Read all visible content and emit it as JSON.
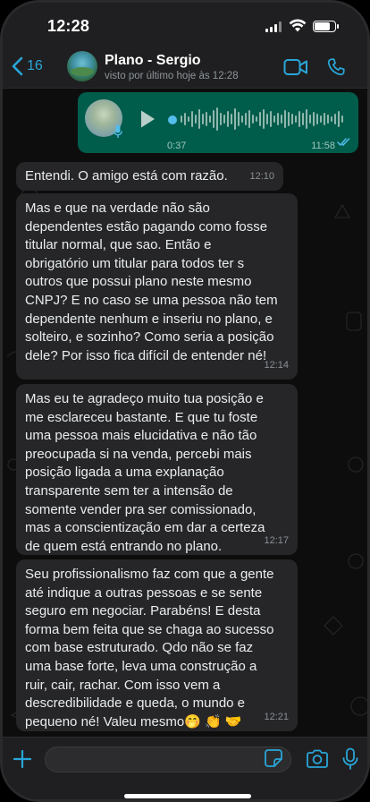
{
  "status_bar": {
    "time": "12:28",
    "battery_level": 0.85
  },
  "header": {
    "back_count": "16",
    "contact_name": "Plano - Sergio",
    "contact_status": "visto por último hoje às 12:28"
  },
  "voice_message": {
    "duration": "0:37",
    "time": "11:58",
    "status": "read"
  },
  "messages": [
    {
      "text": "Entendi. O amigo está com razão.",
      "time": "12:10"
    },
    {
      "text": "Mas e que na verdade não são\ndependentes estão pagando como fosse\ntitular normal, que sao. Então e\nobrigatório um titular para todos ter s\noutros que possui plano neste mesmo\nCNPJ? E no caso se uma pessoa não tem\ndependente nenhum e inseriu no plano, e\nsolteiro, e sozinho? Como seria a posição\ndele? Por isso fica difícil de entender né!",
      "time": "12:14"
    },
    {
      "text": "Mas eu te agradeço muito tua posição e\nme esclareceu bastante. E que tu foste\numa pessoa mais elucidativa e não tão\npreocupada si na venda, percebi mais\nposição ligada a uma explanação\ntransparente sem ter a intensão de\nsomente vender pra ser comissionado,\nmas a conscientização em dar a certeza\nde quem está entrando no plano.",
      "time": "12:17"
    },
    {
      "text": "Seu profissionalismo faz com que a gente\naté indique a outras pessoas e se sente\nseguro em negociar. Parabéns! E desta\nforma bem feita que se chaga ao sucesso\ncom base estruturado. Qdo não se faz\numa base forte, leva uma construção a\nruir, cair, rachar. Com isso vem a\ndescredibilidade e queda, o mundo e\npequeno né! Valeu mesmo🤭 👏 🤝",
      "time": "12:21"
    }
  ],
  "input": {
    "placeholder": ""
  },
  "colors": {
    "accent": "#2aa6d9",
    "outgoing_bubble": "#005c4b",
    "incoming_bubble": "#262628",
    "read_ticks": "#53bdeb"
  }
}
